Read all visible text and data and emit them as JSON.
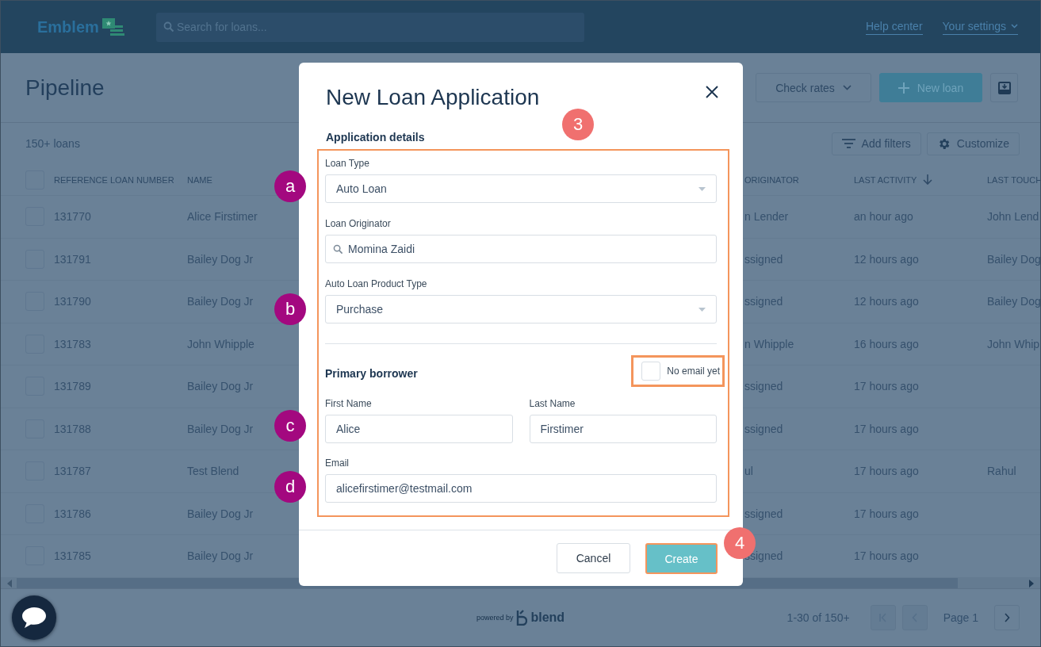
{
  "top_bar": {
    "logo": "Emblem",
    "search": {
      "placeholder": "Search for loans..."
    },
    "links": [
      {
        "label": "Help center",
        "dropdown": false
      },
      {
        "label": "Your settings",
        "dropdown": true
      }
    ]
  },
  "page": {
    "title": "Pipeline",
    "buttons": [
      {
        "label": "Check rates",
        "kind": "dropdown"
      },
      {
        "label": "New loan",
        "kind": "primary"
      },
      {
        "kind": "icon"
      }
    ],
    "count": "150+ loans",
    "tools": [
      {
        "label": "Add filters",
        "kind": "filter"
      },
      {
        "label": "Customize",
        "kind": "gear"
      }
    ]
  },
  "table": {
    "all_checked": false,
    "columns": [
      {
        "label": "REFERENCE LOAN NUMBER",
        "sorted": false
      },
      {
        "label": "NAME",
        "sorted": false
      },
      {
        "label": "ORIGINATOR",
        "sorted": false
      },
      {
        "label": "LAST ACTIVITY",
        "sorted": true
      },
      {
        "label": "LAST TOUCH",
        "sorted": false
      }
    ],
    "rows": [
      {
        "checked": false,
        "ref": "131770",
        "name": "Alice Firstimer",
        "originator": "n Lender",
        "activity": "an hour ago",
        "touch": "John Lend"
      },
      {
        "checked": false,
        "ref": "131791",
        "name": "Bailey Dog Jr",
        "originator": "ssigned",
        "activity": "12 hours ago",
        "touch": "Bailey Dog"
      },
      {
        "checked": false,
        "ref": "131790",
        "name": "Bailey Dog Jr",
        "originator": "ssigned",
        "activity": "12 hours ago",
        "touch": "Bailey Dog"
      },
      {
        "checked": false,
        "ref": "131783",
        "name": "John Whipple",
        "originator": "n Whipple",
        "activity": "16 hours ago",
        "touch": "John Whip"
      },
      {
        "checked": false,
        "ref": "131789",
        "name": "Bailey Dog Jr",
        "originator": "ssigned",
        "activity": "17 hours ago"
      },
      {
        "checked": false,
        "ref": "131788",
        "name": "Bailey Dog Jr",
        "originator": "ssigned",
        "activity": "17 hours ago"
      },
      {
        "checked": false,
        "ref": "131787",
        "name": "Test Blend",
        "originator": "ul",
        "activity": "17 hours ago",
        "touch": "Rahul"
      },
      {
        "checked": false,
        "ref": "131786",
        "name": "Bailey Dog Jr",
        "originator": "ssigned",
        "activity": "17 hours ago"
      },
      {
        "checked": false,
        "ref": "131785",
        "name": "Bailey Dog Jr",
        "originator": "ssigned",
        "activity": "17 hours ago"
      }
    ]
  },
  "footer": {
    "powered_by": "powered by",
    "brand": "blend",
    "range": "1-30 of 150+",
    "page": "Page 1",
    "pager": [
      {
        "kind": "first",
        "disabled": true
      },
      {
        "kind": "prev",
        "disabled": true
      },
      {
        "kind": "next",
        "disabled": false
      }
    ]
  },
  "modal": {
    "title": "New Loan Application",
    "section": "Application details",
    "highlighted": true,
    "fields": [
      {
        "label": "Loan Type",
        "kind": "select",
        "value": "Auto Loan"
      },
      {
        "label": "Loan Originator",
        "kind": "search",
        "value": "Momina Zaidi"
      },
      {
        "label": "Auto Loan Product Type",
        "kind": "select",
        "value": "Purchase"
      }
    ],
    "borrower": {
      "heading": "Primary borrower",
      "no_email": {
        "label": "No email yet",
        "checked": false,
        "highlighted": true
      },
      "first": {
        "label": "First Name",
        "value": "Alice"
      },
      "last": {
        "label": "Last Name",
        "value": "Firstimer"
      },
      "email": {
        "label": "Email",
        "value": "alicefirstimer@testmail.com"
      }
    },
    "buttons": [
      {
        "label": "Cancel",
        "kind": "secondary",
        "highlighted": false
      },
      {
        "label": "Create",
        "kind": "primary",
        "highlighted": true
      }
    ]
  },
  "annotations": [
    {
      "label": "3",
      "kind": "step"
    },
    {
      "label": "a",
      "kind": "letter"
    },
    {
      "label": "b",
      "kind": "letter"
    },
    {
      "label": "c",
      "kind": "letter"
    },
    {
      "label": "d",
      "kind": "letter"
    },
    {
      "label": "4",
      "kind": "step"
    }
  ]
}
